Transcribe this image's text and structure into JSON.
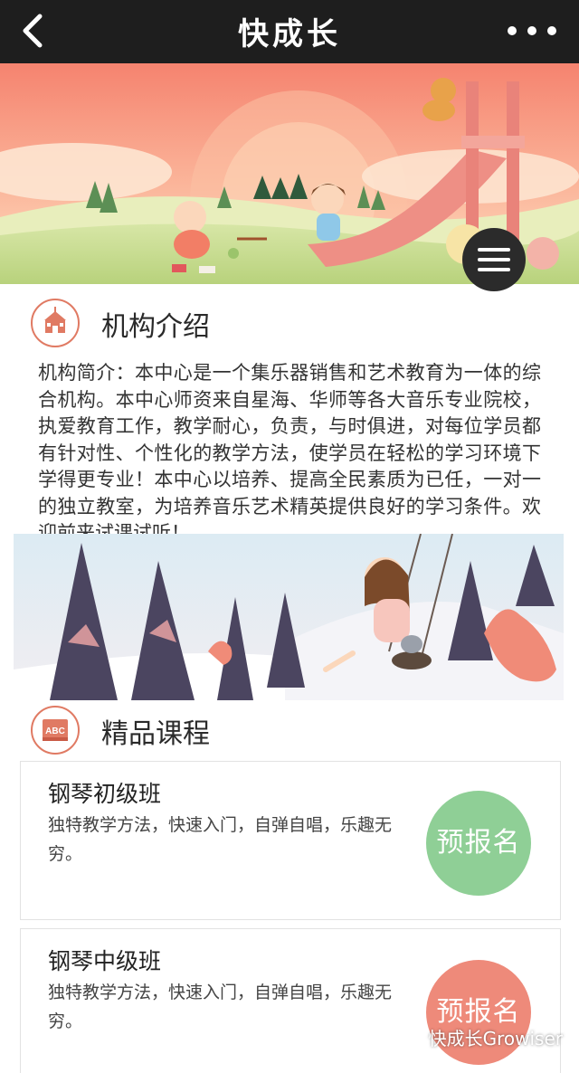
{
  "header": {
    "title": "快成长",
    "back_icon": "chevron-left-icon",
    "more_icon": "more-dots-icon"
  },
  "menu": {
    "icon": "hamburger-menu-icon"
  },
  "intro_section": {
    "title": "机构介绍",
    "icon": "school-building-icon",
    "text": "机构简介：本中心是一个集乐器销售和艺术教育为一体的综合机构。本中心师资来自星海、华师等各大音乐专业院校，执爱教育工作，教学耐心，负责，与时俱进，对每位学员都有针对性、个性化的教学方法，使学员在轻松的学习环境下学得更专业！本中心以培养、提高全民素质为已任，一对一的独立教室，为培养音乐艺术精英提供良好的学习条件。欢迎前来试课试听！"
  },
  "courses_section": {
    "title": "精品课程",
    "icon": "abc-book-icon",
    "items": [
      {
        "title": "钢琴初级班",
        "desc": "独特教学方法，快速入门，自弹自唱，乐趣无穷。",
        "button": "预报名",
        "button_color": "#8fcf96"
      },
      {
        "title": "钢琴中级班",
        "desc": "独特教学方法，快速入门，自弹自唱，乐趣无穷。",
        "button": "预报名",
        "button_color": "#ee8a7a"
      }
    ]
  },
  "watermark": {
    "text": "快成长Growiser",
    "icon": "wechat-icon"
  },
  "colors": {
    "topbar": "#1e1e1e",
    "accent": "#e07a63",
    "banner_sky": "#f79e8a",
    "banner_grass": "#cddf9c"
  }
}
